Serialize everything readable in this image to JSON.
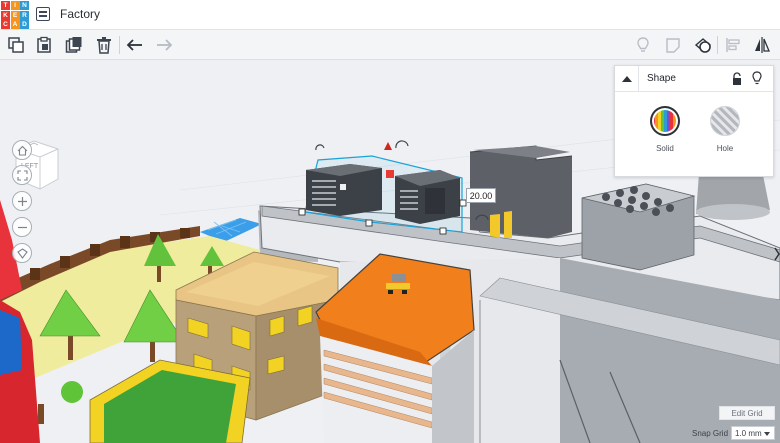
{
  "app": {
    "logo_letters": [
      "T",
      "I",
      "N",
      "K",
      "E",
      "R",
      "C",
      "A",
      "D"
    ],
    "logo_colors": [
      "#e83a30",
      "#f7941e",
      "#2e9bd6",
      "#e83a30",
      "#f7941e",
      "#2e9bd6",
      "#e83a30",
      "#f7941e",
      "#2e9bd6"
    ],
    "project_name": "Factory"
  },
  "toolbar": {
    "left_tools": [
      "copy-icon",
      "paste-icon",
      "duplicate-icon",
      "delete-icon",
      "undo-icon",
      "redo-icon"
    ],
    "right_tools": [
      "lightbulb-icon",
      "note-icon",
      "workplane-shape-icon",
      "align-icon",
      "mirror-icon"
    ]
  },
  "viewport": {
    "view_cube_face": "LEFT",
    "dimension_value": "20.00"
  },
  "shape_panel": {
    "title": "Shape",
    "solid_label": "Solid",
    "hole_label": "Hole"
  },
  "grid": {
    "edit_grid_label": "Edit Grid",
    "snap_grid_label": "Snap Grid",
    "snap_grid_value": "1.0 mm"
  },
  "colors": {
    "accent": "#2e9bd6",
    "selection": "#1aa3d9",
    "orange_roof": "#f07f1c"
  }
}
